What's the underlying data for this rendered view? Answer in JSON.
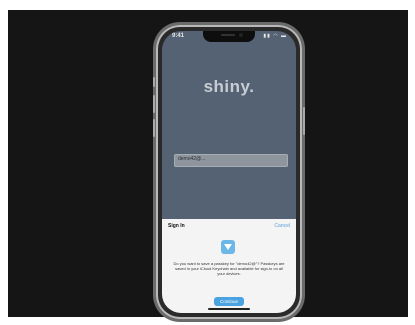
{
  "status_bar": {
    "time": "9:41",
    "icons": "▮▮ ◠ ▬"
  },
  "app": {
    "title": "shiny."
  },
  "login_field": {
    "value": "demo42@..."
  },
  "sign_in_sheet": {
    "title": "Sign In",
    "cancel_label": "Cancel",
    "icon": "shiny-app-icon",
    "message": "Do you want to save a passkey for \"demo42@\"? Passkeys are saved in your iCloud Keychain and available for sign-in on all your devices.",
    "continue_label": "Continue"
  },
  "colors": {
    "background": "#151515",
    "app_background": "#556273",
    "sheet_background": "#f4f4f4",
    "accent": "#4aa3e0"
  }
}
